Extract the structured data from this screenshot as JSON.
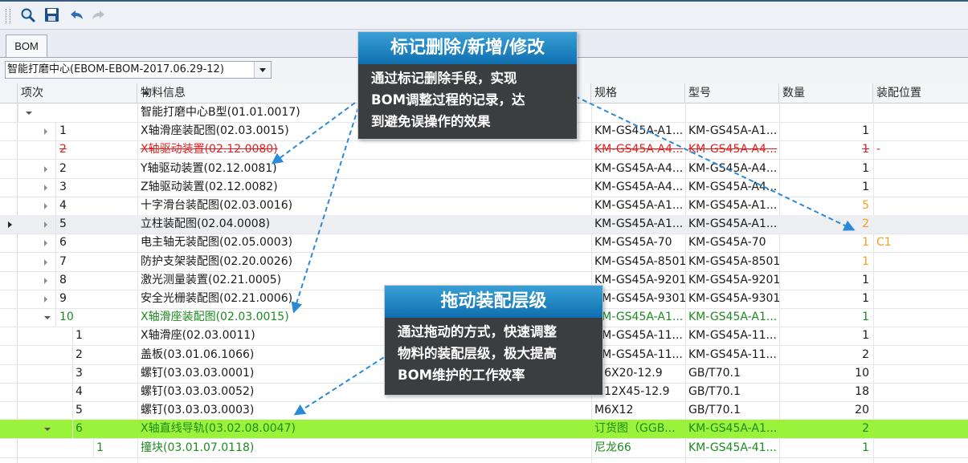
{
  "toolbar": {
    "buttons": [
      "search-icon",
      "save-icon",
      "undo-icon",
      "redo-icon"
    ]
  },
  "tabs": [
    {
      "label": "BOM"
    }
  ],
  "bom_selector": {
    "value": "智能打磨中心(EBOM-EBOM-2017.06.29-12)"
  },
  "grid": {
    "columns": [
      "项次",
      "物料信息",
      "规格",
      "型号",
      "数量",
      "装配位置"
    ],
    "rows": [
      {
        "level": 0,
        "expander": "open",
        "item": "",
        "material": "智能打磨中心B型(01.01.0017)",
        "spec": "",
        "model": "",
        "qty": "",
        "pos": "",
        "style": "normal"
      },
      {
        "level": 1,
        "expander": "collapsed",
        "item": "1",
        "material": "X轴滑座装配图(02.03.0015)",
        "spec": "KM-GS45A-A1...",
        "model": "KM-GS45A-A1...",
        "qty": "1",
        "pos": "",
        "style": "normal"
      },
      {
        "level": 1,
        "expander": "",
        "item": "2",
        "material": "X轴驱动装置(02.12.0080)",
        "spec": "KM-GS45A-A4...",
        "model": "KM-GS45A-A4...",
        "qty": "1",
        "pos": "-",
        "style": "deleted"
      },
      {
        "level": 1,
        "expander": "collapsed",
        "item": "2",
        "material": "Y轴驱动装置(02.12.0081)",
        "spec": "KM-GS45A-A4...",
        "model": "KM-GS45A-A4...",
        "qty": "1",
        "pos": "",
        "style": "normal"
      },
      {
        "level": 1,
        "expander": "collapsed",
        "item": "3",
        "material": "Z轴驱动装置(02.12.0082)",
        "spec": "KM-GS45A-A4...",
        "model": "KM-GS45A-A4...",
        "qty": "1",
        "pos": "",
        "style": "normal"
      },
      {
        "level": 1,
        "expander": "collapsed",
        "item": "4",
        "material": "十字滑台装配图(02.03.0016)",
        "spec": "KM-GS45A-A1...",
        "model": "KM-GS45A-A1...",
        "qty": "5",
        "pos": "",
        "style": "modified"
      },
      {
        "level": 1,
        "expander": "collapsed",
        "item": "5",
        "material": "立柱装配图(02.04.0008)",
        "spec": "KM-GS45A-A1...",
        "model": "KM-GS45A-A1...",
        "qty": "2",
        "pos": "",
        "style": "modified-focus"
      },
      {
        "level": 1,
        "expander": "collapsed",
        "item": "6",
        "material": "电主轴无装配图(02.05.0003)",
        "spec": "KM-GS45A-70",
        "model": "KM-GS45A-70",
        "qty": "1",
        "pos": "C1",
        "style": "modified"
      },
      {
        "level": 1,
        "expander": "collapsed",
        "item": "7",
        "material": "防护支架装配图(02.20.0026)",
        "spec": "KM-GS45A-8501",
        "model": "KM-GS45A-8501",
        "qty": "1",
        "pos": "",
        "style": "modified"
      },
      {
        "level": 1,
        "expander": "collapsed",
        "item": "8",
        "material": "激光测量装置(02.21.0005)",
        "spec": "KM-GS45A-9201",
        "model": "KM-GS45A-9201",
        "qty": "1",
        "pos": "",
        "style": "normal"
      },
      {
        "level": 1,
        "expander": "collapsed",
        "item": "9",
        "material": "安全光栅装配图(02.21.0006)",
        "spec": "KM-GS45A-9301",
        "model": "KM-GS45A-9301",
        "qty": "1",
        "pos": "",
        "style": "normal"
      },
      {
        "level": 1,
        "expander": "open",
        "item": "10",
        "material": "X轴滑座装配图(02.03.0015)",
        "spec": "KM-GS45A-A1...",
        "model": "KM-GS45A-A1...",
        "qty": "1",
        "pos": "",
        "style": "added"
      },
      {
        "level": 2,
        "expander": "",
        "item": "1",
        "material": "X轴滑座(02.03.0011)",
        "spec": "KM-GS45A-11...",
        "model": "KM-GS45A-11...",
        "qty": "1",
        "pos": "",
        "style": "normal"
      },
      {
        "level": 2,
        "expander": "",
        "item": "2",
        "material": "盖板(03.01.06.1066)",
        "spec": "KM-GS45A-11...",
        "model": "KM-GS45A-11...",
        "qty": "2",
        "pos": "",
        "style": "normal"
      },
      {
        "level": 2,
        "expander": "",
        "item": "3",
        "material": "螺钉(03.03.03.0001)",
        "spec": "M6X20-12.9",
        "model": "GB/T70.1",
        "qty": "10",
        "pos": "",
        "style": "normal"
      },
      {
        "level": 2,
        "expander": "",
        "item": "4",
        "material": "螺钉(03.03.03.0052)",
        "spec": "M12X45-12.9",
        "model": "GB/T70.1",
        "qty": "18",
        "pos": "",
        "style": "normal"
      },
      {
        "level": 2,
        "expander": "",
        "item": "5",
        "material": "螺钉(03.03.03.0003)",
        "spec": "M6X12",
        "model": "GB/T70.1",
        "qty": "20",
        "pos": "",
        "style": "normal"
      },
      {
        "level": 2,
        "expander": "open",
        "item": "6",
        "material": "X轴直线导轨(03.02.08.0047)",
        "spec": "订货图（GGB...",
        "model": "KM-GS45A-A1...",
        "qty": "2",
        "pos": "",
        "style": "selected"
      },
      {
        "level": 3,
        "expander": "",
        "item": "1",
        "material": "撞块(03.01.07.0118)",
        "spec": "尼龙66",
        "model": "KM-GS45A-41...",
        "qty": "1",
        "pos": "",
        "style": "added"
      }
    ]
  },
  "callouts": [
    {
      "title": "标记删除/新增/修改",
      "lines": [
        "通过标记删除手段，实现",
        "BOM调整过程的记录，达",
        "到避免误操作的效果"
      ]
    },
    {
      "title": "拖动装配层级",
      "lines": [
        "通过拖动的方式，快速调整",
        "物料的装配层级，极大提高",
        "BOM维护的工作效率"
      ]
    }
  ],
  "colors": {
    "deleted": "#e02020",
    "modified": "#f0a020",
    "added": "#1e8a1e",
    "selected_bg": "#9bf23a",
    "callout_title": "#1d7fc2",
    "arrow": "#2a8ad8"
  }
}
